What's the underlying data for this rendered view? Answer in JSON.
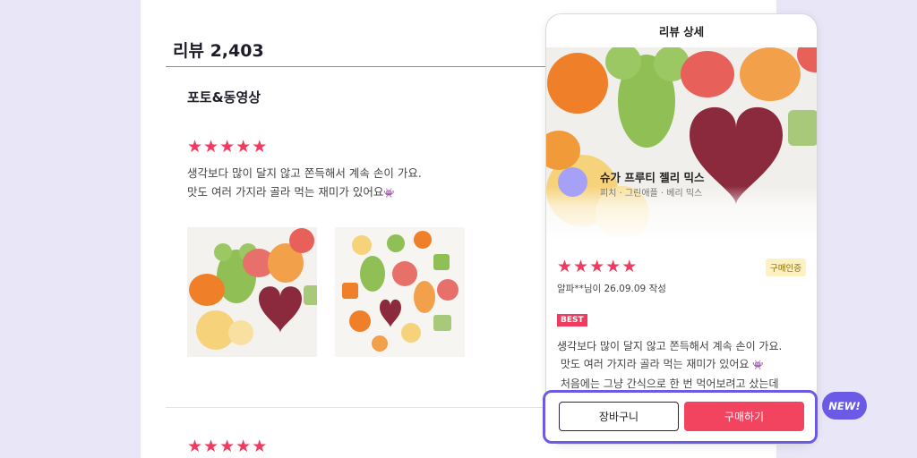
{
  "reviews": {
    "title": "리뷰 2,403",
    "section_title": "포토&동영상",
    "first_review": {
      "rating": 5,
      "line1": "생각보다 많이 달지 않고 쫀득해서 계속 손이 가요.",
      "line2": "맛도 여러 가지라 골라 먹는 재미가 있어요",
      "emoji": "👾"
    },
    "second_review": {
      "rating": 5
    }
  },
  "detail": {
    "header": "리뷰 상세",
    "product_name": "슈가 프루티 젤리 믹스",
    "product_options": "피치 · 그린애플 · 베리 믹스",
    "rating": 5,
    "verified_badge": "구매인증",
    "author_line": "알파**님이 26.09.09 작성",
    "best_badge": "BEST",
    "text_line1": "생각보다 많이 달지 않고 쫀득해서 계속 손이 가요.",
    "text_line2": "맛도 여러 가지라 골라 먹는 재미가 있어요",
    "text_emoji": "👾",
    "text_line3": "처음에는 그냥 간식으로 한 번 먹어보려고 샀는데"
  },
  "actions": {
    "cart_label": "장바구니",
    "buy_label": "구매하기"
  },
  "new_badge": "NEW!",
  "colors": {
    "background": "#e9e6f7",
    "star": "#ef3b5f",
    "accent": "#6a5ae6",
    "buy_button": "#f2445f",
    "avatar": "#a4a1f7"
  },
  "icons": [
    "star-icon"
  ]
}
